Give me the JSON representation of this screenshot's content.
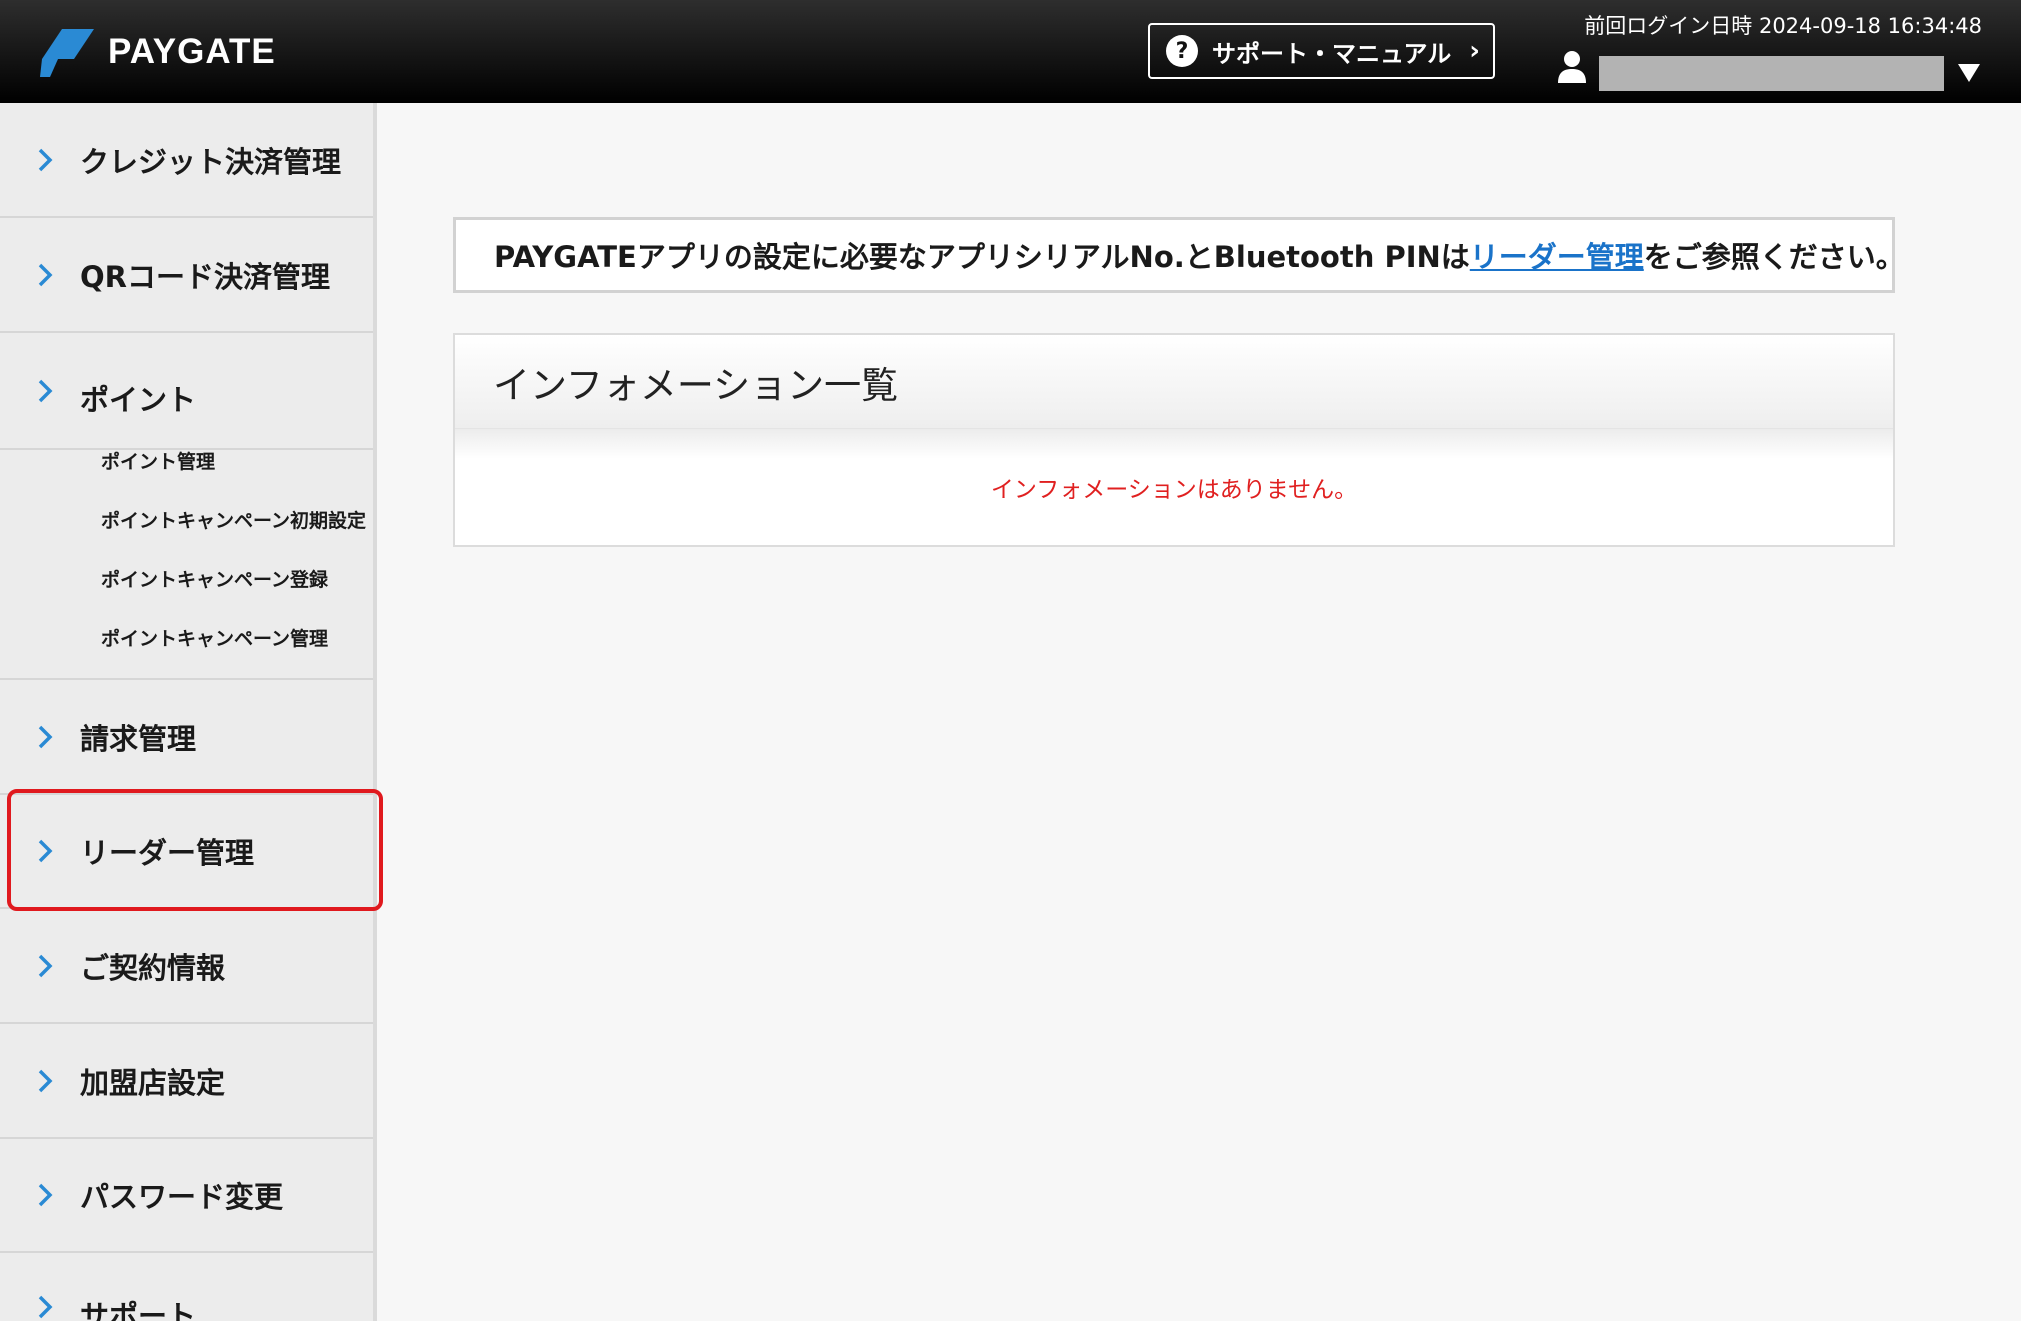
{
  "header": {
    "logo_text": "PAYGATE",
    "support_label": "サポート・マニュアル",
    "last_login": "前回ログイン日時 2024-09-18 16:34:48",
    "user_name": ""
  },
  "sidebar": {
    "items": [
      {
        "label": "クレジット決済管理"
      },
      {
        "label": "QRコード決済管理"
      },
      {
        "label": "ポイント"
      },
      {
        "label": "請求管理"
      },
      {
        "label": "リーダー管理"
      },
      {
        "label": "ご契約情報"
      },
      {
        "label": "加盟店設定"
      },
      {
        "label": "パスワード変更"
      },
      {
        "label": "サポート"
      }
    ],
    "point_sub_items": [
      {
        "label": "ポイント管理"
      },
      {
        "label": "ポイントキャンペーン初期設定"
      },
      {
        "label": "ポイントキャンペーン登録"
      },
      {
        "label": "ポイントキャンペーン管理"
      }
    ]
  },
  "notice": {
    "before": "PAYGATEアプリの設定に必要なアプリシリアルNo.とBluetooth PINは",
    "link": "リーダー管理",
    "after": "をご参照ください。"
  },
  "info": {
    "title": "インフォメーション一覧",
    "empty_message": "インフォメーションはありません。"
  },
  "colors": {
    "accent_chevron": "#2a8ad4",
    "highlight_border": "#e0191e",
    "link": "#1a73c9",
    "empty_message": "#e02020"
  }
}
